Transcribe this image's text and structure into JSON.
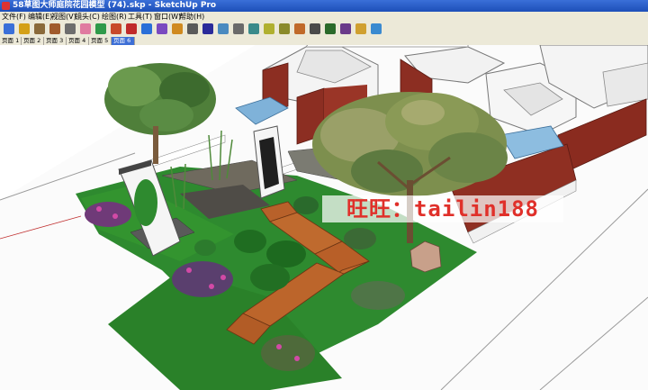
{
  "window": {
    "title": "58草图大师庭院花园模型 (74).skp - SketchUp Pro"
  },
  "menu": [
    "文件(F)",
    "编辑(E)",
    "视图(V)",
    "镜头(C)",
    "绘图(R)",
    "工具(T)",
    "窗口(W)",
    "帮助(H)"
  ],
  "toolbar": [
    "select-arrow-icon",
    "pencil-icon",
    "rectangle-icon",
    "circle-icon",
    "arc-icon",
    "eraser-icon",
    "paint-bucket-icon",
    "push-pull-icon",
    "move-icon",
    "rotate-icon",
    "offset-icon",
    "scale-icon",
    "follow-me-icon",
    "orbit-icon",
    "pan-icon",
    "zoom-icon",
    "zoom-extents-icon",
    "tape-measure-icon",
    "dimension-icon",
    "protractor-icon",
    "text-icon",
    "3d-text-icon",
    "section-plane-icon",
    "components-icon",
    "warehouse-icon"
  ],
  "page_tabs": [
    "页面 1",
    "页面 2",
    "页面 3",
    "页面 4",
    "页面 5",
    "页面 6"
  ],
  "active_tab_index": 5,
  "watermark": "旺旺：tailin188",
  "colors": {
    "title_bar": "#2557c4",
    "chrome": "#ece9d8",
    "grass": "#2e8a2f",
    "wall_brick": "#8c2e22",
    "deck_wood": "#b8612a",
    "active_tab": "#3d6fd6",
    "watermark_text": "#e0302a"
  }
}
